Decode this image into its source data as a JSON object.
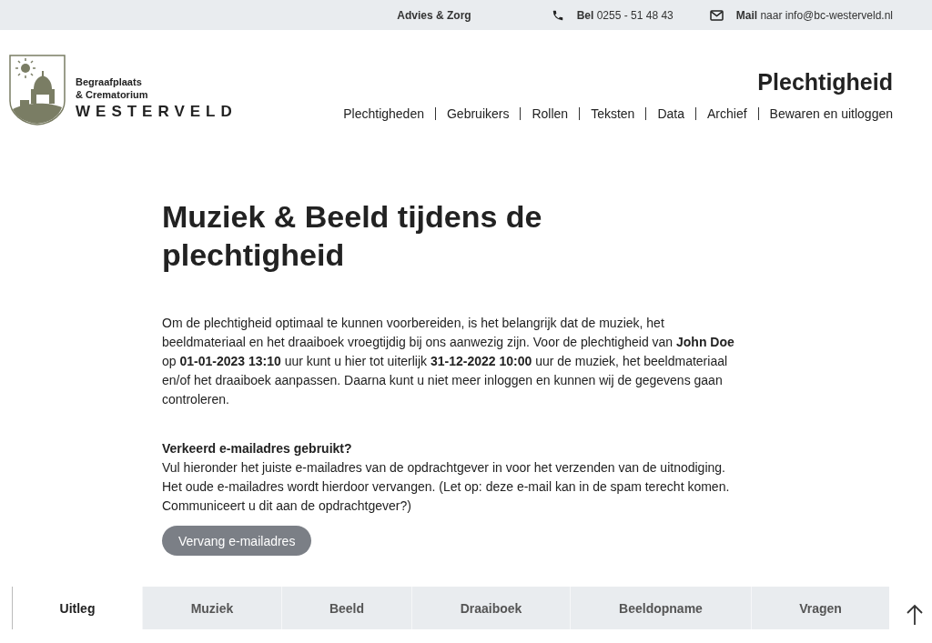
{
  "top_bar": {
    "advice": "Advies & Zorg",
    "phone_label": "Bel",
    "phone": "0255 - 51 48 43",
    "mail_label": "Mail",
    "mail_text": "naar",
    "mail": "info@bc-westerveld.nl"
  },
  "logo": {
    "line_1": "Begraafplaats",
    "line_2": "& Crematorium",
    "name": "WESTERVELD"
  },
  "header": {
    "title": "Plechtigheid",
    "nav": [
      "Plechtigheden",
      "Gebruikers",
      "Rollen",
      "Teksten",
      "Data",
      "Archief",
      "Bewaren en uitloggen"
    ]
  },
  "main": {
    "heading": "Muziek & Beeld tijdens de plechtigheid",
    "intro": "Om de plechtigheid optimaal te kunnen voorbereiden, is het belangrijk dat de muziek, het beeldmateriaal en het draaiboek vroegtijdig bij ons aanwezig zijn. Voor de plechtigheid van **John Doe** op **01-01-2023 13:10** uur kunt u hier tot uiterlijk **31-12-2022 10:00** uur de muziek, het beeldmateriaal en/of het draaiboek aanpassen. Daarna kunt u niet meer inloggen en kunnen wij de gegevens gaan controleren.",
    "email_heading": "Verkeerd e-mailadres gebruikt?",
    "email_text": "Vul hieronder het juiste e-mailadres van de opdrachtgever in voor het verzenden van de uitnodiging. Het oude e-mailadres wordt hierdoor vervangen. (Let op: deze e-mail kan in de spam terecht komen. Communiceert u dit aan de opdrachtgever?)",
    "button": "Vervang e-mailadres"
  },
  "tabs": [
    {
      "label": "Uitleg",
      "selected": true
    },
    {
      "label": "Muziek",
      "selected": false
    },
    {
      "label": "Beeld",
      "selected": false
    },
    {
      "label": "Draaiboek",
      "selected": false
    },
    {
      "label": "Beeldopname",
      "selected": false
    },
    {
      "label": "Vragen",
      "selected": false
    }
  ]
}
